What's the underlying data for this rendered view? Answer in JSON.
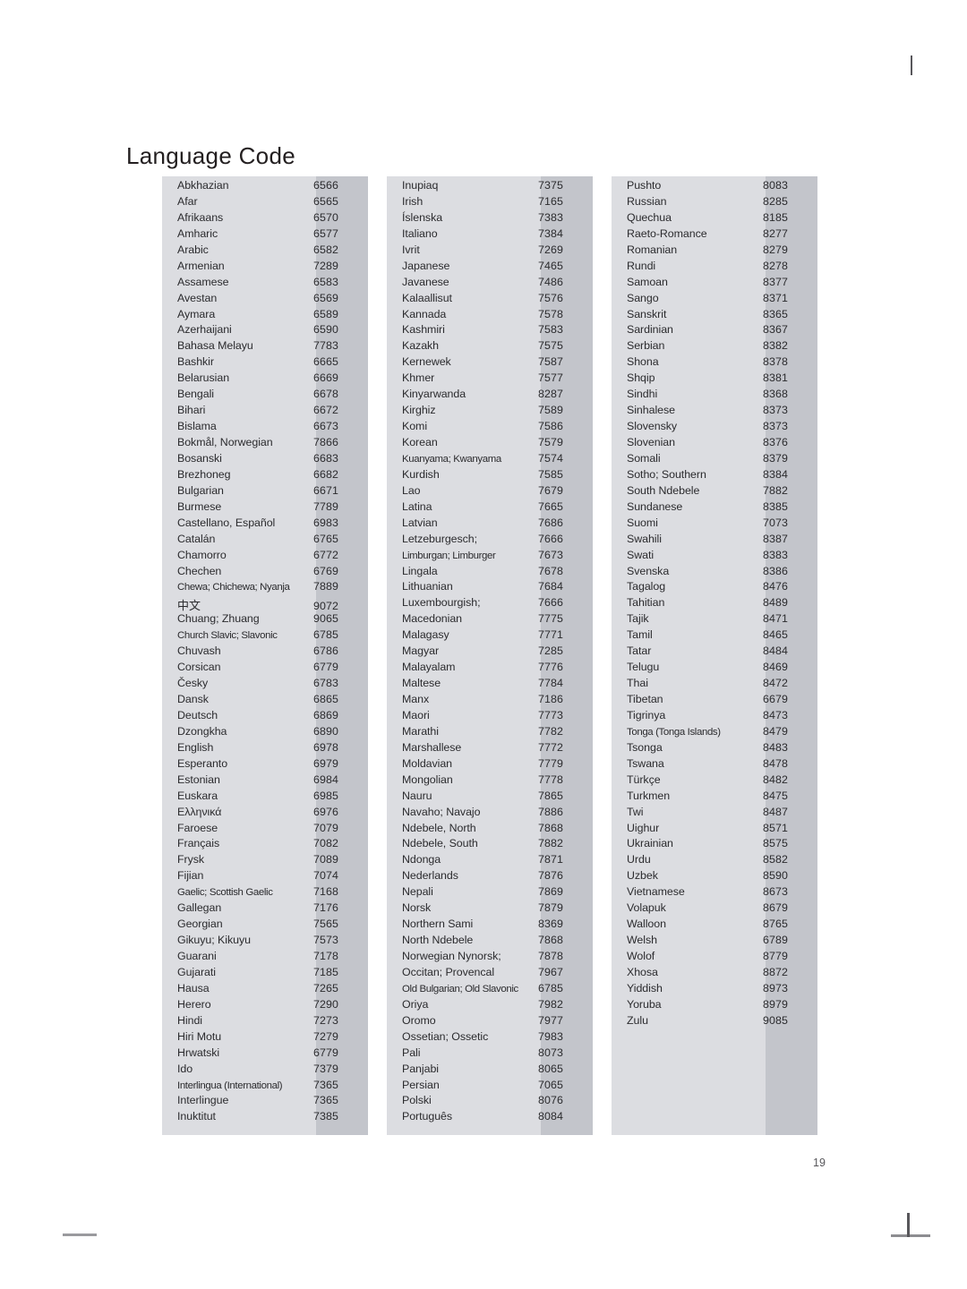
{
  "page": {
    "title": "Language Code",
    "number": "19"
  },
  "columns": [
    {
      "id": "column-1",
      "rows": [
        {
          "name": "Abkhazian",
          "code": "6566"
        },
        {
          "name": "Afar",
          "code": "6565"
        },
        {
          "name": "Afrikaans",
          "code": "6570"
        },
        {
          "name": "Amharic",
          "code": "6577"
        },
        {
          "name": "Arabic",
          "code": "6582"
        },
        {
          "name": "Armenian",
          "code": "7289"
        },
        {
          "name": "Assamese",
          "code": "6583"
        },
        {
          "name": "Avestan",
          "code": "6569"
        },
        {
          "name": "Aymara",
          "code": "6589"
        },
        {
          "name": "Azerhaijani",
          "code": "6590"
        },
        {
          "name": "Bahasa Melayu",
          "code": "7783"
        },
        {
          "name": "Bashkir",
          "code": "6665"
        },
        {
          "name": "Belarusian",
          "code": "6669"
        },
        {
          "name": "Bengali",
          "code": "6678"
        },
        {
          "name": "Bihari",
          "code": "6672"
        },
        {
          "name": "Bislama",
          "code": "6673"
        },
        {
          "name": "Bokmål, Norwegian",
          "code": "7866"
        },
        {
          "name": "Bosanski",
          "code": "6683"
        },
        {
          "name": "Brezhoneg",
          "code": "6682"
        },
        {
          "name": "Bulgarian",
          "code": "6671"
        },
        {
          "name": "Burmese",
          "code": "7789"
        },
        {
          "name": "Castellano, Español",
          "code": "6983"
        },
        {
          "name": "Catalán",
          "code": "6765"
        },
        {
          "name": "Chamorro",
          "code": "6772"
        },
        {
          "name": "Chechen",
          "code": "6769"
        },
        {
          "name": "Chewa; Chichewa; Nyanja",
          "code": "7889",
          "tight": true
        },
        {
          "name": "中文",
          "code": "9072",
          "cjk": true
        },
        {
          "name": "Chuang; Zhuang",
          "code": "9065"
        },
        {
          "name": "Church Slavic; Slavonic",
          "code": "6785",
          "tight": true
        },
        {
          "name": "Chuvash",
          "code": "6786"
        },
        {
          "name": "Corsican",
          "code": "6779"
        },
        {
          "name": "Česky",
          "code": "6783"
        },
        {
          "name": "Dansk",
          "code": "6865"
        },
        {
          "name": "Deutsch",
          "code": "6869"
        },
        {
          "name": "Dzongkha",
          "code": "6890"
        },
        {
          "name": "English",
          "code": "6978"
        },
        {
          "name": "Esperanto",
          "code": "6979"
        },
        {
          "name": "Estonian",
          "code": "6984"
        },
        {
          "name": "Euskara",
          "code": "6985"
        },
        {
          "name": "Ελληνικά",
          "code": "6976"
        },
        {
          "name": "Faroese",
          "code": "7079"
        },
        {
          "name": "Français",
          "code": "7082"
        },
        {
          "name": "Frysk",
          "code": "7089"
        },
        {
          "name": "Fijian",
          "code": "7074"
        },
        {
          "name": "Gaelic; Scottish Gaelic",
          "code": "7168",
          "tight": true
        },
        {
          "name": "Gallegan",
          "code": "7176"
        },
        {
          "name": "Georgian",
          "code": "7565"
        },
        {
          "name": "Gikuyu; Kikuyu",
          "code": "7573"
        },
        {
          "name": "Guarani",
          "code": "7178"
        },
        {
          "name": "Gujarati",
          "code": "7185"
        },
        {
          "name": "Hausa",
          "code": "7265"
        },
        {
          "name": "Herero",
          "code": "7290"
        },
        {
          "name": "Hindi",
          "code": "7273"
        },
        {
          "name": "Hiri Motu",
          "code": "7279"
        },
        {
          "name": "Hrwatski",
          "code": "6779"
        },
        {
          "name": "Ido",
          "code": "7379"
        },
        {
          "name": "Interlingua (International)",
          "code": "7365",
          "tight": true
        },
        {
          "name": "Interlingue",
          "code": "7365"
        },
        {
          "name": "Inuktitut",
          "code": "7385"
        }
      ]
    },
    {
      "id": "column-2",
      "rows": [
        {
          "name": "Inupiaq",
          "code": "7375"
        },
        {
          "name": "Irish",
          "code": "7165"
        },
        {
          "name": "Íslenska",
          "code": "7383"
        },
        {
          "name": "Italiano",
          "code": "7384"
        },
        {
          "name": "Ivrit",
          "code": "7269"
        },
        {
          "name": "Japanese",
          "code": "7465"
        },
        {
          "name": "Javanese",
          "code": "7486"
        },
        {
          "name": "Kalaallisut",
          "code": "7576"
        },
        {
          "name": "Kannada",
          "code": "7578"
        },
        {
          "name": "Kashmiri",
          "code": "7583"
        },
        {
          "name": "Kazakh",
          "code": "7575"
        },
        {
          "name": "Kernewek",
          "code": "7587"
        },
        {
          "name": "Khmer",
          "code": "7577"
        },
        {
          "name": "Kinyarwanda",
          "code": "8287"
        },
        {
          "name": "Kirghiz",
          "code": "7589"
        },
        {
          "name": "Komi",
          "code": "7586"
        },
        {
          "name": "Korean",
          "code": "7579"
        },
        {
          "name": "Kuanyama; Kwanyama",
          "code": "7574",
          "tight": true
        },
        {
          "name": "Kurdish",
          "code": "7585"
        },
        {
          "name": "Lao",
          "code": "7679"
        },
        {
          "name": "Latina",
          "code": "7665"
        },
        {
          "name": "Latvian",
          "code": "7686"
        },
        {
          "name": "Letzeburgesch;",
          "code": "7666"
        },
        {
          "name": "Limburgan; Limburger",
          "code": "7673",
          "tight": true
        },
        {
          "name": "Lingala",
          "code": "7678"
        },
        {
          "name": "Lithuanian",
          "code": "7684"
        },
        {
          "name": "Luxembourgish;",
          "code": "7666"
        },
        {
          "name": "Macedonian",
          "code": "7775"
        },
        {
          "name": "Malagasy",
          "code": "7771"
        },
        {
          "name": "Magyar",
          "code": "7285"
        },
        {
          "name": "Malayalam",
          "code": "7776"
        },
        {
          "name": "Maltese",
          "code": "7784"
        },
        {
          "name": "Manx",
          "code": "7186"
        },
        {
          "name": "Maori",
          "code": "7773"
        },
        {
          "name": "Marathi",
          "code": "7782"
        },
        {
          "name": "Marshallese",
          "code": "7772"
        },
        {
          "name": "Moldavian",
          "code": "7779"
        },
        {
          "name": "Mongolian",
          "code": "7778"
        },
        {
          "name": "Nauru",
          "code": "7865"
        },
        {
          "name": "Navaho; Navajo",
          "code": "7886"
        },
        {
          "name": "Ndebele, North",
          "code": "7868"
        },
        {
          "name": "Ndebele, South",
          "code": "7882"
        },
        {
          "name": "Ndonga",
          "code": "7871"
        },
        {
          "name": "Nederlands",
          "code": "7876"
        },
        {
          "name": "Nepali",
          "code": "7869"
        },
        {
          "name": "Norsk",
          "code": "7879"
        },
        {
          "name": "Northern Sami",
          "code": "8369"
        },
        {
          "name": "North Ndebele",
          "code": "7868"
        },
        {
          "name": "Norwegian Nynorsk;",
          "code": "7878"
        },
        {
          "name": "Occitan; Provencal",
          "code": "7967"
        },
        {
          "name": "Old Bulgarian; Old Slavonic",
          "code": "6785",
          "tight": true
        },
        {
          "name": "Oriya",
          "code": "7982"
        },
        {
          "name": "Oromo",
          "code": "7977"
        },
        {
          "name": "Ossetian; Ossetic",
          "code": "7983"
        },
        {
          "name": "Pali",
          "code": "8073"
        },
        {
          "name": "Panjabi",
          "code": "8065"
        },
        {
          "name": "Persian",
          "code": "7065"
        },
        {
          "name": "Polski",
          "code": "8076"
        },
        {
          "name": "Português",
          "code": "8084"
        }
      ]
    },
    {
      "id": "column-3",
      "rows": [
        {
          "name": "Pushto",
          "code": "8083"
        },
        {
          "name": "Russian",
          "code": "8285"
        },
        {
          "name": "Quechua",
          "code": "8185"
        },
        {
          "name": "Raeto-Romance",
          "code": "8277"
        },
        {
          "name": "Romanian",
          "code": "8279"
        },
        {
          "name": "Rundi",
          "code": "8278"
        },
        {
          "name": "Samoan",
          "code": "8377"
        },
        {
          "name": "Sango",
          "code": "8371"
        },
        {
          "name": "Sanskrit",
          "code": "8365"
        },
        {
          "name": "Sardinian",
          "code": "8367"
        },
        {
          "name": "Serbian",
          "code": "8382"
        },
        {
          "name": "Shona",
          "code": "8378"
        },
        {
          "name": "Shqip",
          "code": "8381"
        },
        {
          "name": "Sindhi",
          "code": "8368"
        },
        {
          "name": "Sinhalese",
          "code": "8373"
        },
        {
          "name": "Slovensky",
          "code": "8373"
        },
        {
          "name": "Slovenian",
          "code": "8376"
        },
        {
          "name": "Somali",
          "code": "8379"
        },
        {
          "name": "Sotho; Southern",
          "code": "8384"
        },
        {
          "name": "South Ndebele",
          "code": "7882"
        },
        {
          "name": "Sundanese",
          "code": "8385"
        },
        {
          "name": "Suomi",
          "code": "7073"
        },
        {
          "name": "Swahili",
          "code": "8387"
        },
        {
          "name": "Swati",
          "code": "8383"
        },
        {
          "name": "Svenska",
          "code": "8386"
        },
        {
          "name": "Tagalog",
          "code": "8476"
        },
        {
          "name": "Tahitian",
          "code": "8489"
        },
        {
          "name": "Tajik",
          "code": "8471"
        },
        {
          "name": "Tamil",
          "code": "8465"
        },
        {
          "name": "Tatar",
          "code": "8484"
        },
        {
          "name": "Telugu",
          "code": "8469"
        },
        {
          "name": "Thai",
          "code": "8472"
        },
        {
          "name": "Tibetan",
          "code": "6679"
        },
        {
          "name": "Tigrinya",
          "code": "8473"
        },
        {
          "name": "Tonga (Tonga Islands)",
          "code": "8479",
          "tight": true
        },
        {
          "name": "Tsonga",
          "code": "8483"
        },
        {
          "name": "Tswana",
          "code": "8478"
        },
        {
          "name": "Türkçe",
          "code": "8482"
        },
        {
          "name": "Turkmen",
          "code": "8475"
        },
        {
          "name": "Twi",
          "code": "8487"
        },
        {
          "name": "Uighur",
          "code": "8571"
        },
        {
          "name": "Ukrainian",
          "code": "8575"
        },
        {
          "name": "Urdu",
          "code": "8582"
        },
        {
          "name": "Uzbek",
          "code": "8590"
        },
        {
          "name": "Vietnamese",
          "code": "8673"
        },
        {
          "name": "Volapuk",
          "code": "8679"
        },
        {
          "name": "Walloon",
          "code": "8765"
        },
        {
          "name": "Welsh",
          "code": "6789"
        },
        {
          "name": "Wolof",
          "code": "8779"
        },
        {
          "name": "Xhosa",
          "code": "8872"
        },
        {
          "name": "Yiddish",
          "code": "8973"
        },
        {
          "name": "Yoruba",
          "code": "8979"
        },
        {
          "name": "Zulu",
          "code": "9085"
        }
      ]
    }
  ],
  "colors": {
    "column_background": "#dcdde1",
    "code_strip_background": "#c3c5cb",
    "text": "#2b2b2e",
    "title": "#231f20",
    "page_background": "#ffffff"
  }
}
